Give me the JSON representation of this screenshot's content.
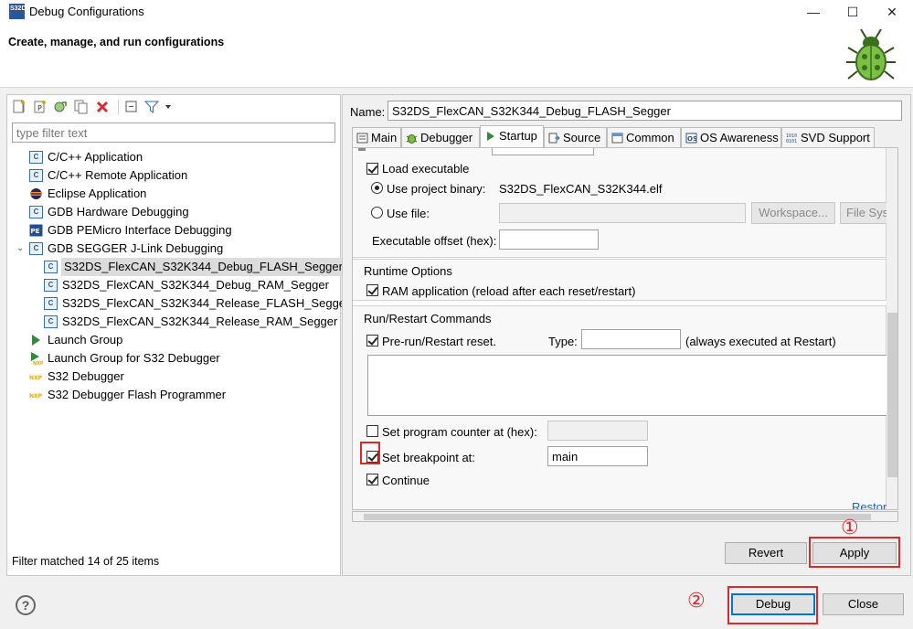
{
  "window": {
    "title": "Debug Configurations",
    "app_icon_text": "S32DS",
    "minimize": "—",
    "maximize": "☐",
    "close": "✕"
  },
  "banner": {
    "title": "Create, manage, and run configurations"
  },
  "left": {
    "filter_placeholder": "type filter text",
    "tree": [
      {
        "label": "C/C++ Application",
        "icon": "c-config-icon"
      },
      {
        "label": "C/C++ Remote Application",
        "icon": "c-config-icon"
      },
      {
        "label": "Eclipse Application",
        "icon": "eclipse-icon"
      },
      {
        "label": "GDB Hardware Debugging",
        "icon": "c-config-icon"
      },
      {
        "label": "GDB PEMicro Interface Debugging",
        "icon": "pemicro-icon"
      },
      {
        "label": "GDB SEGGER J-Link Debugging",
        "icon": "c-config-icon",
        "expanded": true
      },
      {
        "label": "S32DS_FlexCAN_S32K344_Debug_FLASH_Segger",
        "icon": "c-config-icon",
        "selected": true
      },
      {
        "label": "S32DS_FlexCAN_S32K344_Debug_RAM_Segger",
        "icon": "c-config-icon"
      },
      {
        "label": "S32DS_FlexCAN_S32K344_Release_FLASH_Segger",
        "icon": "c-config-icon"
      },
      {
        "label": "S32DS_FlexCAN_S32K344_Release_RAM_Segger",
        "icon": "c-config-icon"
      },
      {
        "label": "Launch Group",
        "icon": "launch-group-icon"
      },
      {
        "label": "Launch Group for S32 Debugger",
        "icon": "launch-group-nxp-icon"
      },
      {
        "label": "S32 Debugger",
        "icon": "nxp-icon"
      },
      {
        "label": "S32 Debugger Flash Programmer",
        "icon": "nxp-icon"
      }
    ],
    "status": "Filter matched 14 of 25 items"
  },
  "right": {
    "name_label": "Name:",
    "name_value": "S32DS_FlexCAN_S32K344_Debug_FLASH_Segger",
    "tabs": [
      "Main",
      "Debugger",
      "Startup",
      "Source",
      "Common",
      "OS Awareness",
      "SVD Support"
    ],
    "active_tab": "Startup",
    "startup": {
      "load_executable": "Load executable",
      "use_project_binary": "Use project binary:",
      "project_binary": "S32DS_FlexCAN_S32K344.elf",
      "use_file": "Use file:",
      "workspace_btn": "Workspace...",
      "filesystem_btn": "File System...",
      "exec_offset": "Executable offset (hex):",
      "runtime_title": "Runtime Options",
      "ram_application": "RAM application (reload after each reset/restart)",
      "restart_title": "Run/Restart Commands",
      "prerun_reset": "Pre-run/Restart reset.",
      "type_label": "Type:",
      "always_executed": "(always executed at Restart)",
      "set_pc": "Set program counter at (hex):",
      "set_breakpoint": "Set breakpoint at:",
      "breakpoint_value": "main",
      "continue": "Continue",
      "restore_link": "Restore defaults"
    },
    "revert": "Revert",
    "apply": "Apply"
  },
  "footer": {
    "help": "?",
    "debug": "Debug",
    "close": "Close"
  },
  "annotations": {
    "one": "①",
    "two": "②"
  },
  "colors": {
    "annotation": "#d92b2b",
    "selection": "#dcdcdc"
  }
}
